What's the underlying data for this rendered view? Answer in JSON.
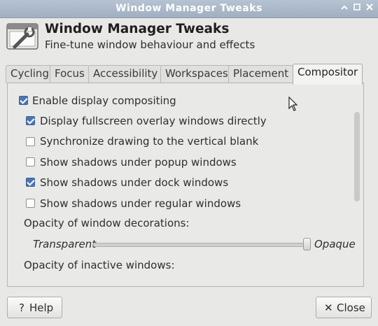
{
  "window": {
    "title": "Window Manager Tweaks",
    "controls": [
      "chevron-up-icon",
      "restore-icon",
      "close-icon"
    ]
  },
  "header": {
    "title": "Window Manager Tweaks",
    "subtitle": "Fine-tune window behaviour and effects",
    "icon": "settings-wrench-icon"
  },
  "tabs": [
    {
      "label": "Cycling",
      "active": false
    },
    {
      "label": "Focus",
      "active": false
    },
    {
      "label": "Accessibility",
      "active": false
    },
    {
      "label": "Workspaces",
      "active": false
    },
    {
      "label": "Placement",
      "active": false
    },
    {
      "label": "Compositor",
      "active": true
    }
  ],
  "compositor": {
    "enable_label": "Enable display compositing",
    "enable_checked": true,
    "options": [
      {
        "label": "Display fullscreen overlay windows directly",
        "checked": true
      },
      {
        "label": "Synchronize drawing to the vertical blank",
        "checked": false
      },
      {
        "label": "Show shadows under popup windows",
        "checked": false
      },
      {
        "label": "Show shadows under dock windows",
        "checked": true
      },
      {
        "label": "Show shadows under regular windows",
        "checked": false
      }
    ],
    "decorations_opacity_label": "Opacity of window decorations:",
    "slider_min_label": "Transparent",
    "slider_max_label": "Opaque",
    "decorations_opacity_value": 1.0,
    "inactive_opacity_label": "Opacity of inactive windows:"
  },
  "buttons": {
    "help_label": "Help",
    "help_icon": "?",
    "close_label": "Close",
    "close_icon": "✕"
  },
  "colors": {
    "titlebar": "#a8b6c7",
    "checkbox_checked": "#4a77b4"
  }
}
